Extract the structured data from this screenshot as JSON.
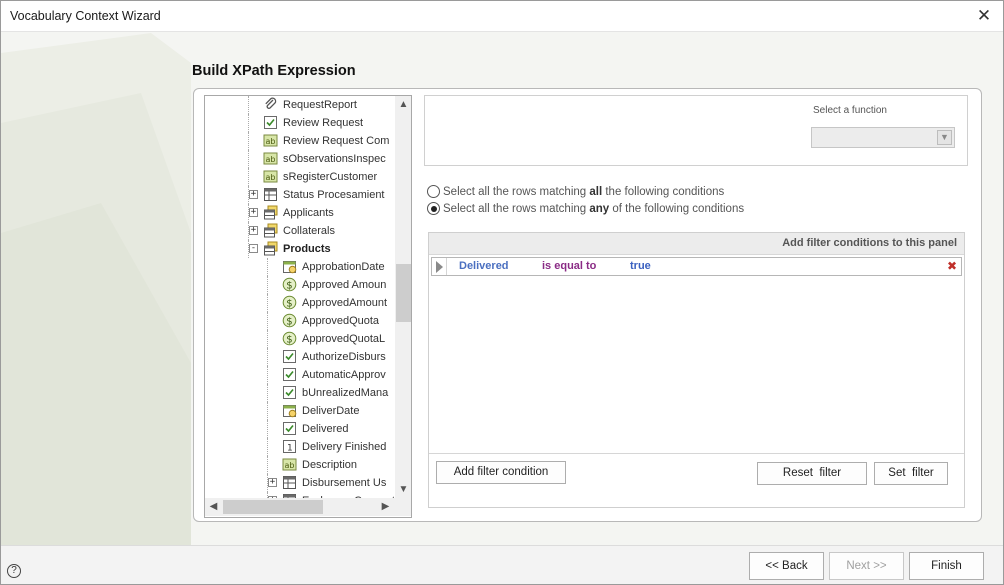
{
  "window": {
    "title": "Vocabulary Context Wizard"
  },
  "heading": "Build XPath Expression",
  "tree": {
    "items": [
      {
        "label": "RequestReport",
        "icon": "paperclip-icon",
        "indent": 1,
        "expander": "",
        "bold": false
      },
      {
        "label": "Review Request",
        "icon": "checkbox-icon",
        "indent": 1,
        "expander": "",
        "bold": false
      },
      {
        "label": "Review Request Com",
        "icon": "text-ab-icon",
        "indent": 1,
        "expander": "",
        "bold": false
      },
      {
        "label": "sObservationsInspec",
        "icon": "text-ab-icon",
        "indent": 1,
        "expander": "",
        "bold": false
      },
      {
        "label": "sRegisterCustomer",
        "icon": "text-ab-icon",
        "indent": 1,
        "expander": "",
        "bold": false
      },
      {
        "label": "Status Procesamient",
        "icon": "table-icon",
        "indent": 1,
        "expander": "+",
        "bold": false
      },
      {
        "label": "Applicants",
        "icon": "collection-icon",
        "indent": 1,
        "expander": "+",
        "bold": false
      },
      {
        "label": "Collaterals",
        "icon": "collection-icon",
        "indent": 1,
        "expander": "+",
        "bold": false
      },
      {
        "label": "Products",
        "icon": "collection-icon",
        "indent": 1,
        "expander": "-",
        "bold": true
      },
      {
        "label": "ApprobationDate",
        "icon": "calendar-icon",
        "indent": 2,
        "expander": "",
        "bold": false
      },
      {
        "label": "Approved Amoun",
        "icon": "dollar-icon",
        "indent": 2,
        "expander": "",
        "bold": false
      },
      {
        "label": "ApprovedAmount",
        "icon": "dollar-icon",
        "indent": 2,
        "expander": "",
        "bold": false
      },
      {
        "label": "ApprovedQuota",
        "icon": "dollar-icon",
        "indent": 2,
        "expander": "",
        "bold": false
      },
      {
        "label": "ApprovedQuotaL",
        "icon": "dollar-icon",
        "indent": 2,
        "expander": "",
        "bold": false
      },
      {
        "label": "AuthorizeDisburs",
        "icon": "checkbox-icon",
        "indent": 2,
        "expander": "",
        "bold": false
      },
      {
        "label": "AutomaticApprov",
        "icon": "checkbox-icon",
        "indent": 2,
        "expander": "",
        "bold": false
      },
      {
        "label": "bUnrealizedMana",
        "icon": "checkbox-icon",
        "indent": 2,
        "expander": "",
        "bold": false
      },
      {
        "label": "DeliverDate",
        "icon": "calendar-icon",
        "indent": 2,
        "expander": "",
        "bold": false
      },
      {
        "label": "Delivered",
        "icon": "checkbox-icon",
        "indent": 2,
        "expander": "",
        "bold": false
      },
      {
        "label": "Delivery Finished",
        "icon": "number-icon",
        "indent": 2,
        "expander": "",
        "bold": false
      },
      {
        "label": "Description",
        "icon": "text-ab-icon",
        "indent": 2,
        "expander": "",
        "bold": false
      },
      {
        "label": "Disbursement Us",
        "icon": "table-icon",
        "indent": 2,
        "expander": "+",
        "bold": false
      },
      {
        "label": "Exchange Concept",
        "icon": "table-icon",
        "indent": 2,
        "expander": "+",
        "bold": false
      }
    ]
  },
  "function_panel": {
    "label": "Select a function",
    "selected": ""
  },
  "radios": [
    {
      "before": "Select all the rows matching ",
      "emph": "all",
      "after": " the following conditions",
      "checked": false
    },
    {
      "before": "Select all the rows matching ",
      "emph": "any",
      "after": " of the following conditions",
      "checked": true
    }
  ],
  "filter": {
    "header": "Add filter conditions to this panel",
    "conditions": [
      {
        "field": "Delivered",
        "operator": "is equal to",
        "value": "true"
      }
    ],
    "delete_glyph": "✖",
    "add_button": "Add filter condition",
    "reset_button": "Reset  filter",
    "set_button": "Set  filter"
  },
  "nav": {
    "back": "<< Back",
    "next": "Next >>",
    "finish": "Finish"
  },
  "help_glyph": "?",
  "close_glyph": "✕"
}
